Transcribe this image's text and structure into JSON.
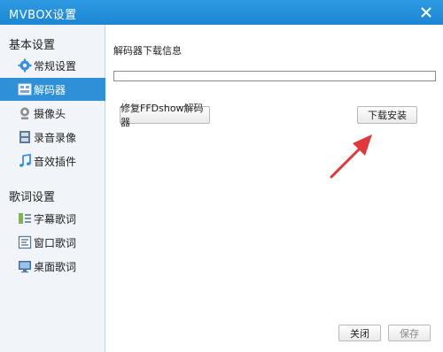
{
  "window": {
    "title": "MVBOX设置"
  },
  "sidebar": {
    "sections": [
      {
        "title": "基本设置",
        "items": [
          {
            "label": "常规设置",
            "icon": "gear-icon",
            "active": false
          },
          {
            "label": "解码器",
            "icon": "decoder-icon",
            "active": true
          },
          {
            "label": "摄像头",
            "icon": "webcam-icon",
            "active": false
          },
          {
            "label": "录音录像",
            "icon": "film-icon",
            "active": false
          },
          {
            "label": "音效插件",
            "icon": "music-note-icon",
            "active": false
          }
        ]
      },
      {
        "title": "歌词设置",
        "items": [
          {
            "label": "字幕歌词",
            "icon": "subtitle-lyrics-icon",
            "active": false
          },
          {
            "label": "窗口歌词",
            "icon": "window-lyrics-icon",
            "active": false
          },
          {
            "label": "桌面歌词",
            "icon": "desktop-lyrics-icon",
            "active": false
          }
        ]
      }
    ]
  },
  "decoder": {
    "info_label": "解码器下载信息",
    "progress": 0,
    "repair_button": "修复FFDshow解码器",
    "install_button": "下载安装"
  },
  "footer": {
    "close_button": "关闭",
    "save_button": "保存"
  },
  "colors": {
    "titlebar": "#1c86d3",
    "active_item": "#2f8fd7",
    "annotation_arrow": "#e0393b"
  }
}
